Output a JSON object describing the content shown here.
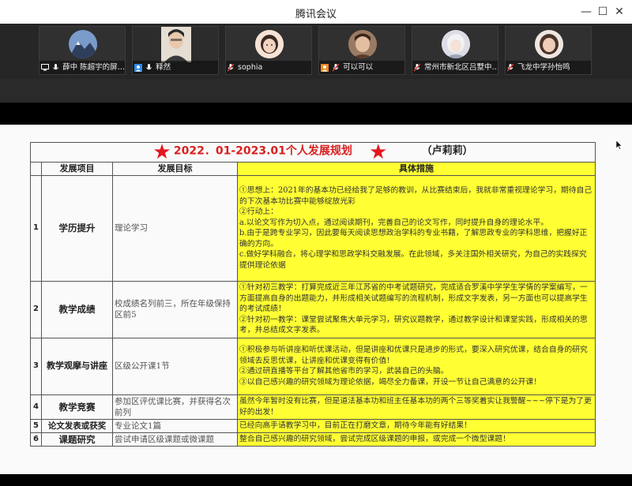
{
  "window": {
    "title": "腾讯会议",
    "minimize": "—",
    "maximize": "☐",
    "close": "✕"
  },
  "participants": [
    {
      "name": "薛中 陈超宇的屏…",
      "avatar_color": "#4a6fa5",
      "mic": "on",
      "share": true
    },
    {
      "name": "释然",
      "avatar_color": "#d9cfc3",
      "mic": "on",
      "host": true
    },
    {
      "name": "sophia",
      "avatar_color": "#f1d6c6",
      "mic": "muted"
    },
    {
      "name": "可以可以",
      "avatar_color": "#8a6a55",
      "mic": "muted",
      "host": true
    },
    {
      "name": "常州市新北区吕墅中…",
      "avatar_color": "#c9c9d6",
      "mic": "muted"
    },
    {
      "name": "飞龙中学孙怡鸣",
      "avatar_color": "#d8b6a8",
      "mic": "muted"
    }
  ],
  "sheet": {
    "title": "2022．01-2023.01个人发展规划",
    "author": "（卢莉莉）",
    "headers": [
      "发展项目",
      "发展目标",
      "具体措施"
    ],
    "rows": [
      {
        "num": "1",
        "item": "学历提升",
        "goal": "理论学习",
        "measures": [
          "①思想上：2021年的基本功已经给我了足够的教训，从比赛结束后，我就非常重视理论学习，期待自己的下次基本功比赛中能够绽放光彩",
          "②行动上：",
          "a.以论文写作为切入点，通过阅读期刊，完善自己的论文写作，同时提升自身的理论水平。",
          "b.由于是跨专业学习，因此要每天阅读思想政治学科的专业书籍，了解思政专业的学科思维，把握好正确的方向。",
          "c.做好学科融合，将心理学和思政学科交融发展。在此领域，多关注国外相关研究，为自己的实践探究提供理论依据"
        ]
      },
      {
        "num": "2",
        "item": "教学成绩",
        "goal": "校成绩名列前三，所在年级保持区前5",
        "measures": [
          "①针对初三教学：打算完成近三年江苏省的中考试题研究，完成适合罗溪中学学生学情的学案编写，一方面提高自身的出题能力，并形成相关试题编写的流程机制，形成文字发表，另一方面也可以提高学生的考试成绩！",
          "②针对初一教学：课堂尝试聚焦大单元学习，研究议题教学，通过教学设计和课堂实践，形成相关的思考，并总结成文字发表。"
        ]
      },
      {
        "num": "3",
        "item": "教学观摩与讲座",
        "goal": "区级公开课1节",
        "measures": [
          "①积极参与听讲座和听优课活动，但是讲座和优课只是进步的形式，要深入研究优课，结合自身的研究领域去反思优课，让讲座和优课变得有价值！",
          "②通过研直播等平台了解其他省市的学习，武装自己的头脑。",
          "③以自己感兴趣的研究领域为理论依据，竭尽全力备课，开设一节让自己满意的公开课！"
        ]
      },
      {
        "num": "4",
        "item": "教学竞赛",
        "goal": "参加区评优课比赛，并获得名次前列",
        "measures": [
          "虽然今年暂时没有比赛，但是道法基本功和班主任基本功的两个三等奖着实让我警醒~~~停下是为了更好的出发！"
        ]
      },
      {
        "num": "5",
        "item": "论文发表或获奖",
        "goal": "专业论文1篇",
        "measures": [
          "已经向高手请教学习中，目前正在打磨文章，期待今年能有好结果！"
        ]
      },
      {
        "num": "6",
        "item": "课题研究",
        "goal": "尝试申请区级课题或微课题",
        "measures": [
          "整合自己感兴趣的研究领域，尝试完成区级课题的申报，或完成一个微型课题！"
        ]
      }
    ]
  },
  "colors": {
    "highlight": "#ffff33",
    "title_red": "#d92020",
    "star_red": "#e3171f"
  }
}
